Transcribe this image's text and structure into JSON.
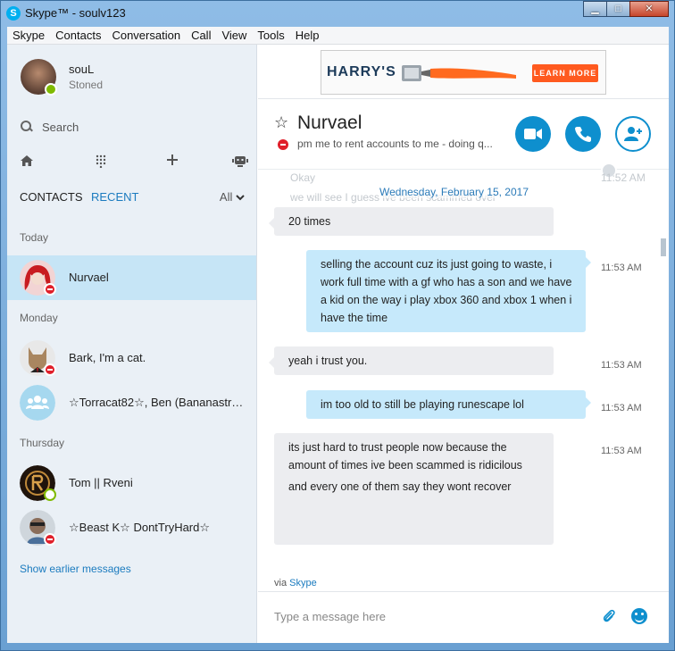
{
  "window": {
    "title": "Skype™ - soulv123",
    "controls": {
      "minimize": "▁",
      "maximize": "□",
      "close": "✕"
    }
  },
  "menu": [
    "Skype",
    "Contacts",
    "Conversation",
    "Call",
    "View",
    "Tools",
    "Help"
  ],
  "profile": {
    "name": "souL",
    "mood": "Stoned",
    "status": "online"
  },
  "search": {
    "label": "Search"
  },
  "nav_icons": [
    "home-icon",
    "dialpad-icon",
    "plus-icon",
    "bot-icon"
  ],
  "tabs": {
    "contacts": "CONTACTS",
    "recent": "RECENT",
    "filter": "All"
  },
  "sections": {
    "today": "Today",
    "monday": "Monday",
    "thursday": "Thursday"
  },
  "conversations": [
    {
      "name": "Nurvael",
      "status": "dnd",
      "active": true
    },
    {
      "name": "Bark, I'm a cat.",
      "status": "dnd"
    },
    {
      "name": "☆Torracat82☆, Ben (Bananastr…",
      "status": "group"
    },
    {
      "name": "Tom || Rveni",
      "status": "away"
    },
    {
      "name": "☆Beast K☆ DontTryHard☆",
      "status": "dnd"
    }
  ],
  "show_earlier": "Show earlier messages",
  "ad": {
    "brand": "HARRY'S",
    "cta": "LEARN MORE"
  },
  "chat": {
    "contact_name": "Nurvael",
    "mood": "pm me to rent accounts to me - doing q...",
    "date_separator": "Wednesday, February 15, 2017",
    "ghost_text_1": "Okay",
    "ghost_text_2": "we will see I guess ive been scammed over",
    "ghost_time": "11:52 AM",
    "messages": [
      {
        "direction": "in",
        "text": "20 times",
        "time": ""
      },
      {
        "direction": "out",
        "text": "selling the account cuz its just going to waste, i work full time with a gf who has a son and we have a kid on the way i play xbox 360 and xbox 1 when i have the time",
        "time": "11:53 AM"
      },
      {
        "direction": "in",
        "text": "yeah i trust you.",
        "time": "11:53 AM"
      },
      {
        "direction": "out",
        "text": "im too old to still be playing runescape lol",
        "time": "11:53 AM"
      },
      {
        "direction": "in",
        "text": "its just hard to trust people now because the amount of times ive been scammed is ridicilous",
        "text2": "and every one of them say they wont recover",
        "time": "11:53 AM"
      }
    ],
    "via_prefix": "via",
    "via_link": "Skype",
    "compose_placeholder": "Type a message here"
  },
  "colors": {
    "accent": "#0e8fce",
    "link": "#1b7bbf",
    "active_row": "#c6e5f6",
    "outgoing_bubble": "#c6e9fb",
    "incoming_bubble": "#ecedf0",
    "dnd": "#e01f2a",
    "online": "#7fba00"
  }
}
